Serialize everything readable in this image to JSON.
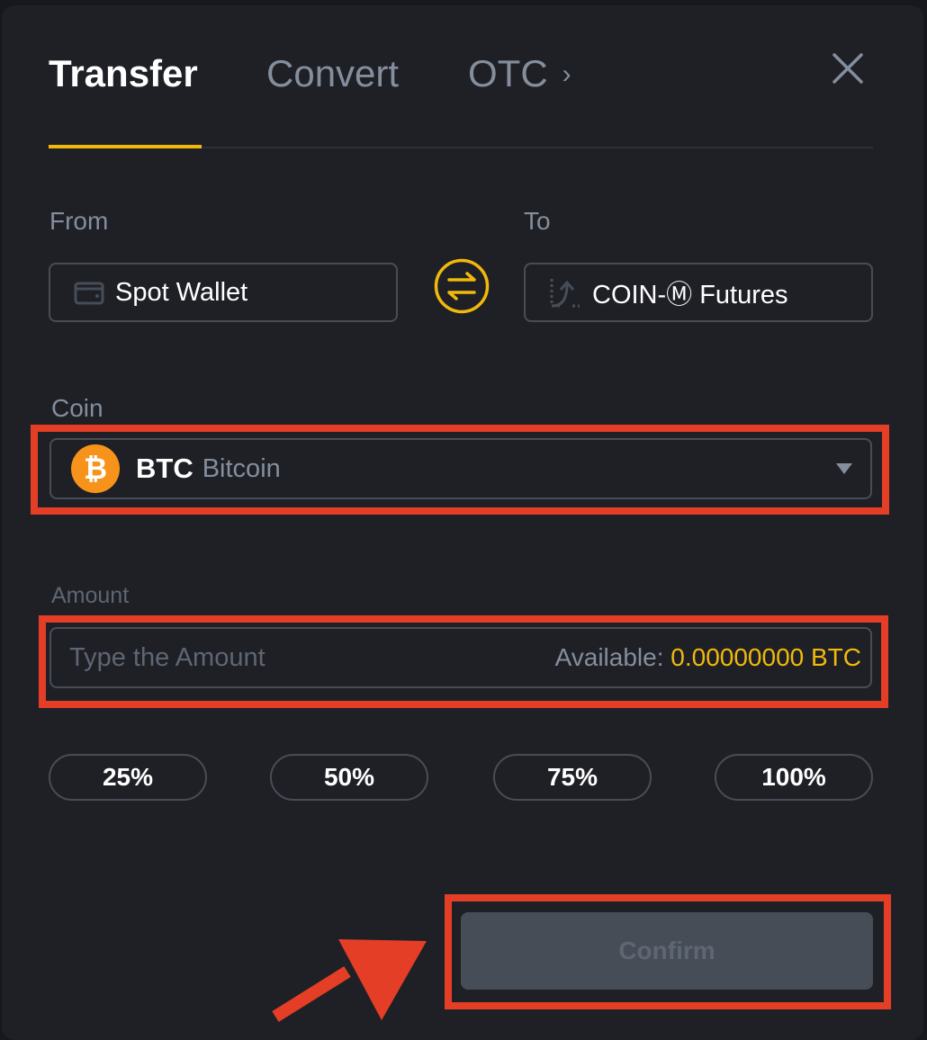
{
  "tabs": [
    {
      "label": "Transfer",
      "active": true
    },
    {
      "label": "Convert",
      "active": false
    },
    {
      "label": "OTC",
      "active": false
    }
  ],
  "otc_chevron": "›",
  "close_icon": "close-icon",
  "from": {
    "label": "From",
    "wallet": "Spot Wallet",
    "icon": "wallet-icon"
  },
  "to": {
    "label": "To",
    "wallet": "COIN-Ⓜ Futures",
    "icon": "futures-icon"
  },
  "swap_icon": "swap-arrows-icon",
  "coin": {
    "label": "Coin",
    "symbol": "BTC",
    "name": "Bitcoin",
    "logo_glyph": "₿"
  },
  "amount": {
    "label": "Amount",
    "placeholder": "Type the Amount",
    "value": "",
    "available_label": "Available:",
    "available_value": "0.00000000 BTC"
  },
  "percent_buttons": [
    "25%",
    "50%",
    "75%",
    "100%"
  ],
  "confirm_label": "Confirm",
  "colors": {
    "accent": "#f0b90b",
    "highlight": "#e53e26",
    "background": "#1f2026",
    "btc": "#f7931a"
  }
}
